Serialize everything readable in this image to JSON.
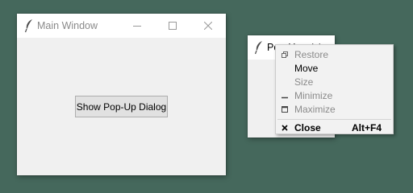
{
  "main_window": {
    "title": "Main Window",
    "button_label": "Show Pop-Up Dialog"
  },
  "popup_window": {
    "title": "Pop-Up"
  },
  "system_menu": {
    "items": [
      {
        "label": "Restore",
        "icon": "restore-icon",
        "enabled": false
      },
      {
        "label": "Move",
        "icon": "",
        "enabled": true
      },
      {
        "label": "Size",
        "icon": "",
        "enabled": false
      },
      {
        "label": "Minimize",
        "icon": "minimize-icon",
        "enabled": false
      },
      {
        "label": "Maximize",
        "icon": "maximize-icon",
        "enabled": false
      },
      {
        "label": "Close",
        "icon": "close-icon",
        "enabled": true,
        "shortcut": "Alt+F4"
      }
    ]
  },
  "colors": {
    "desktop": "#45685c",
    "window_bg": "#f0f0f0",
    "titlebar_bg": "#ffffff",
    "disabled_text": "#8b8b8b"
  }
}
